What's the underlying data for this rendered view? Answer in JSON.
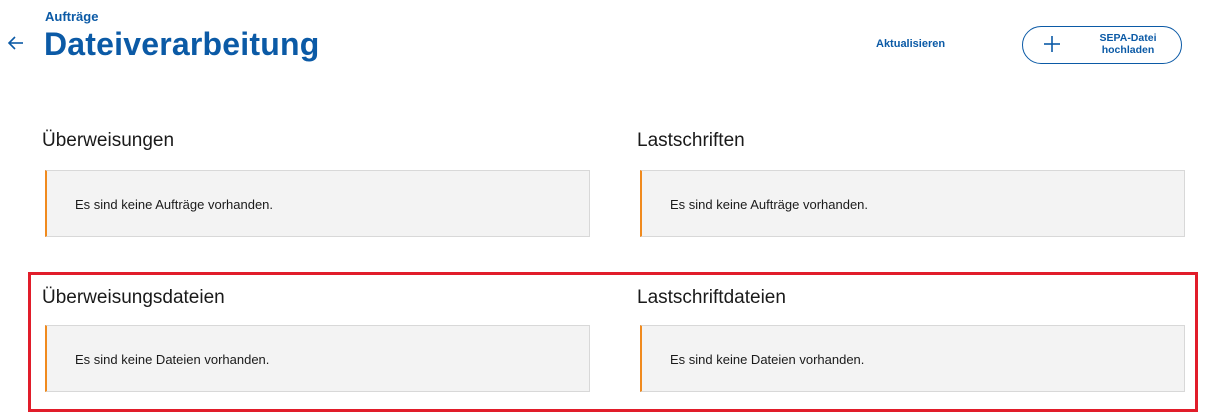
{
  "header": {
    "breadcrumb": "Aufträge",
    "title": "Dateiverarbeitung",
    "refresh_label": "Aktualisieren",
    "upload_label": "SEPA-Datei\nhochladen",
    "back_icon": "arrow-left-icon",
    "upload_icon": "plus-icon"
  },
  "sections": {
    "transfers": {
      "title": "Überweisungen",
      "empty": "Es sind keine Aufträge vorhanden."
    },
    "debits": {
      "title": "Lastschriften",
      "empty": "Es sind keine Aufträge vorhanden."
    },
    "transfer_files": {
      "title": "Überweisungsdateien",
      "empty": "Es sind keine Dateien vorhanden."
    },
    "debit_files": {
      "title": "Lastschriftdateien",
      "empty": "Es sind keine Dateien vorhanden."
    }
  },
  "colors": {
    "brand_blue": "#0b5aa6",
    "accent_orange": "#f08a1e",
    "highlight_red": "#e11d2a",
    "box_bg": "#f3f3f3"
  }
}
